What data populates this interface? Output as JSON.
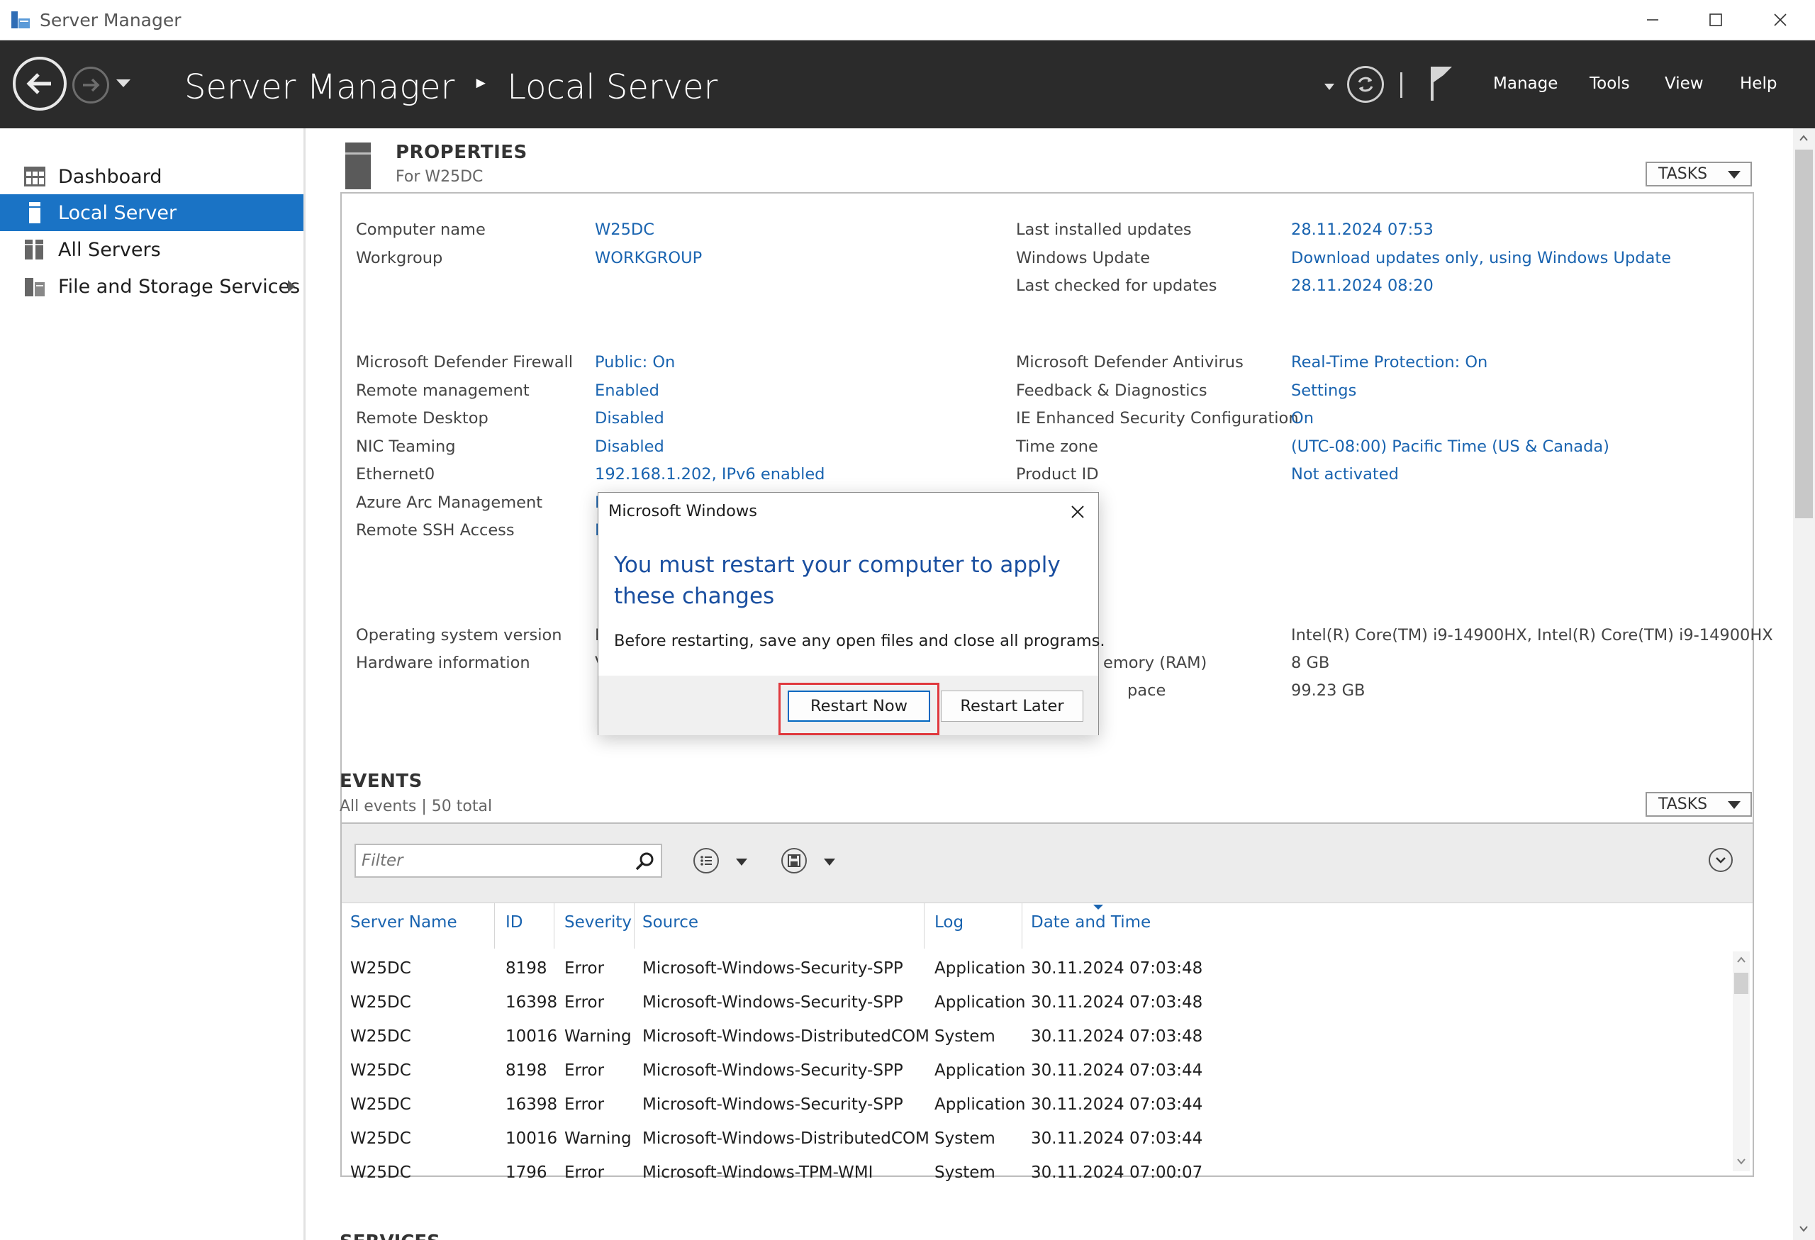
{
  "window": {
    "title": "Server Manager"
  },
  "header": {
    "breadcrumb_root": "Server Manager",
    "breadcrumb_current": "Local Server",
    "menu": [
      "Manage",
      "Tools",
      "View",
      "Help"
    ]
  },
  "sidebar": {
    "items": [
      {
        "label": "Dashboard",
        "icon": "dashboard-icon"
      },
      {
        "label": "Local Server",
        "icon": "local-server-icon",
        "active": true
      },
      {
        "label": "All Servers",
        "icon": "all-servers-icon"
      },
      {
        "label": "File and Storage Services",
        "icon": "file-storage-icon",
        "has_submenu": true
      }
    ]
  },
  "properties": {
    "title": "PROPERTIES",
    "subtitle": "For W25DC",
    "tasks_label": "TASKS",
    "left": [
      {
        "label": "Computer name",
        "value": "W25DC"
      },
      {
        "label": "Workgroup",
        "value": "WORKGROUP"
      },
      {
        "label": "Microsoft Defender Firewall",
        "value": "Public: On"
      },
      {
        "label": "Remote management",
        "value": "Enabled"
      },
      {
        "label": "Remote Desktop",
        "value": "Disabled"
      },
      {
        "label": "NIC Teaming",
        "value": "Disabled"
      },
      {
        "label": "Ethernet0",
        "value": "192.168.1.202, IPv6 enabled"
      },
      {
        "label": "Azure Arc Management",
        "value": "D"
      },
      {
        "label": "Remote SSH Access",
        "value": "D"
      },
      {
        "label": "Operating system version",
        "value": "M"
      },
      {
        "label": "Hardware information",
        "value": "V"
      }
    ],
    "right": [
      {
        "label": "Last installed updates",
        "value": "28.11.2024 07:53"
      },
      {
        "label": "Windows Update",
        "value": "Download updates only, using Windows Update"
      },
      {
        "label": "Last checked for updates",
        "value": "28.11.2024 08:20"
      },
      {
        "label": "Microsoft Defender Antivirus",
        "value": "Real-Time Protection: On"
      },
      {
        "label": "Feedback & Diagnostics",
        "value": "Settings"
      },
      {
        "label": "IE Enhanced Security Configuration",
        "value": "On"
      },
      {
        "label": "Time zone",
        "value": "(UTC-08:00) Pacific Time (US & Canada)"
      },
      {
        "label": "Product ID",
        "value": "Not activated"
      },
      {
        "label": "",
        "value": "Intel(R) Core(TM) i9-14900HX, Intel(R) Core(TM) i9-14900HX"
      },
      {
        "label": "emory (RAM)",
        "value": "8 GB"
      },
      {
        "label": "pace",
        "value": "99.23 GB"
      }
    ]
  },
  "dialog": {
    "title": "Microsoft Windows",
    "heading": "You must restart your computer to apply these changes",
    "message": "Before restarting, save any open files and close all programs.",
    "primary_button": "Restart Now",
    "secondary_button": "Restart Later"
  },
  "events": {
    "title": "EVENTS",
    "subtitle": "All events | 50 total",
    "tasks_label": "TASKS",
    "filter_placeholder": "Filter",
    "columns": [
      "Server Name",
      "ID",
      "Severity",
      "Source",
      "Log",
      "Date and Time"
    ],
    "rows": [
      [
        "W25DC",
        "8198",
        "Error",
        "Microsoft-Windows-Security-SPP",
        "Application",
        "30.11.2024 07:03:48"
      ],
      [
        "W25DC",
        "16398",
        "Error",
        "Microsoft-Windows-Security-SPP",
        "Application",
        "30.11.2024 07:03:48"
      ],
      [
        "W25DC",
        "10016",
        "Warning",
        "Microsoft-Windows-DistributedCOM",
        "System",
        "30.11.2024 07:03:48"
      ],
      [
        "W25DC",
        "8198",
        "Error",
        "Microsoft-Windows-Security-SPP",
        "Application",
        "30.11.2024 07:03:44"
      ],
      [
        "W25DC",
        "16398",
        "Error",
        "Microsoft-Windows-Security-SPP",
        "Application",
        "30.11.2024 07:03:44"
      ],
      [
        "W25DC",
        "10016",
        "Warning",
        "Microsoft-Windows-DistributedCOM",
        "System",
        "30.11.2024 07:03:44"
      ],
      [
        "W25DC",
        "1796",
        "Error",
        "Microsoft-Windows-TPM-WMI",
        "System",
        "30.11.2024 07:00:07"
      ]
    ]
  },
  "services": {
    "title": "SERVICES"
  }
}
